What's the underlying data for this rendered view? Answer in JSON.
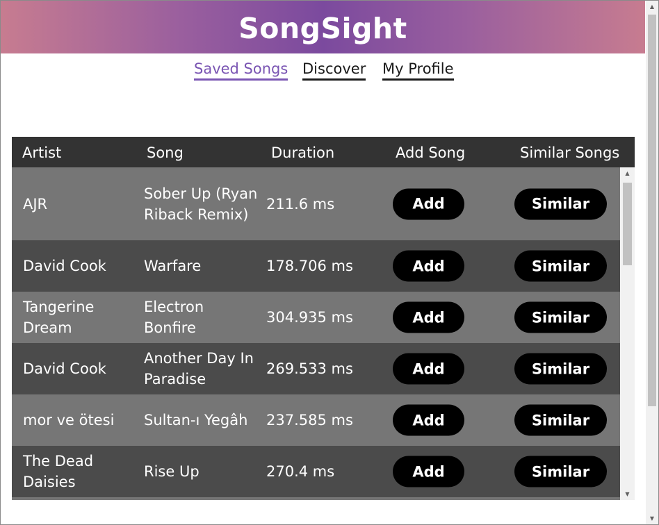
{
  "app": {
    "title": "SongSight"
  },
  "nav": {
    "items": [
      {
        "label": "Saved Songs",
        "active": true
      },
      {
        "label": "Discover",
        "active": false
      },
      {
        "label": "My Profile",
        "active": false
      }
    ]
  },
  "table": {
    "headers": {
      "artist": "Artist",
      "song": "Song",
      "duration": "Duration",
      "add": "Add Song",
      "similar": "Similar Songs"
    },
    "rows": [
      {
        "artist": "AJR",
        "song": "Sober Up (Ryan Riback Remix)",
        "duration": "211.6 ms",
        "add_label": "Add",
        "similar_label": "Similar"
      },
      {
        "artist": "David Cook",
        "song": "Warfare",
        "duration": "178.706 ms",
        "add_label": "Add",
        "similar_label": "Similar"
      },
      {
        "artist": "Tangerine Dream",
        "song": "Electron Bonfire",
        "duration": "304.935 ms",
        "add_label": "Add",
        "similar_label": "Similar"
      },
      {
        "artist": "David Cook",
        "song": "Another Day In Paradise",
        "duration": "269.533 ms",
        "add_label": "Add",
        "similar_label": "Similar"
      },
      {
        "artist": "mor ve ötesi",
        "song": "Sultan-ı Yegâh",
        "duration": "237.585 ms",
        "add_label": "Add",
        "similar_label": "Similar"
      },
      {
        "artist": "The Dead Daisies",
        "song": "Rise Up",
        "duration": "270.4 ms",
        "add_label": "Add",
        "similar_label": "Similar"
      }
    ]
  },
  "colors": {
    "header_gradient_edge": "#c77c90",
    "header_gradient_center": "#7b4a9e",
    "nav_active": "#7a55b3",
    "table_header_bg": "#333333",
    "row_light": "#767676",
    "row_dark": "#4b4b4b",
    "button_bg": "#000000"
  }
}
